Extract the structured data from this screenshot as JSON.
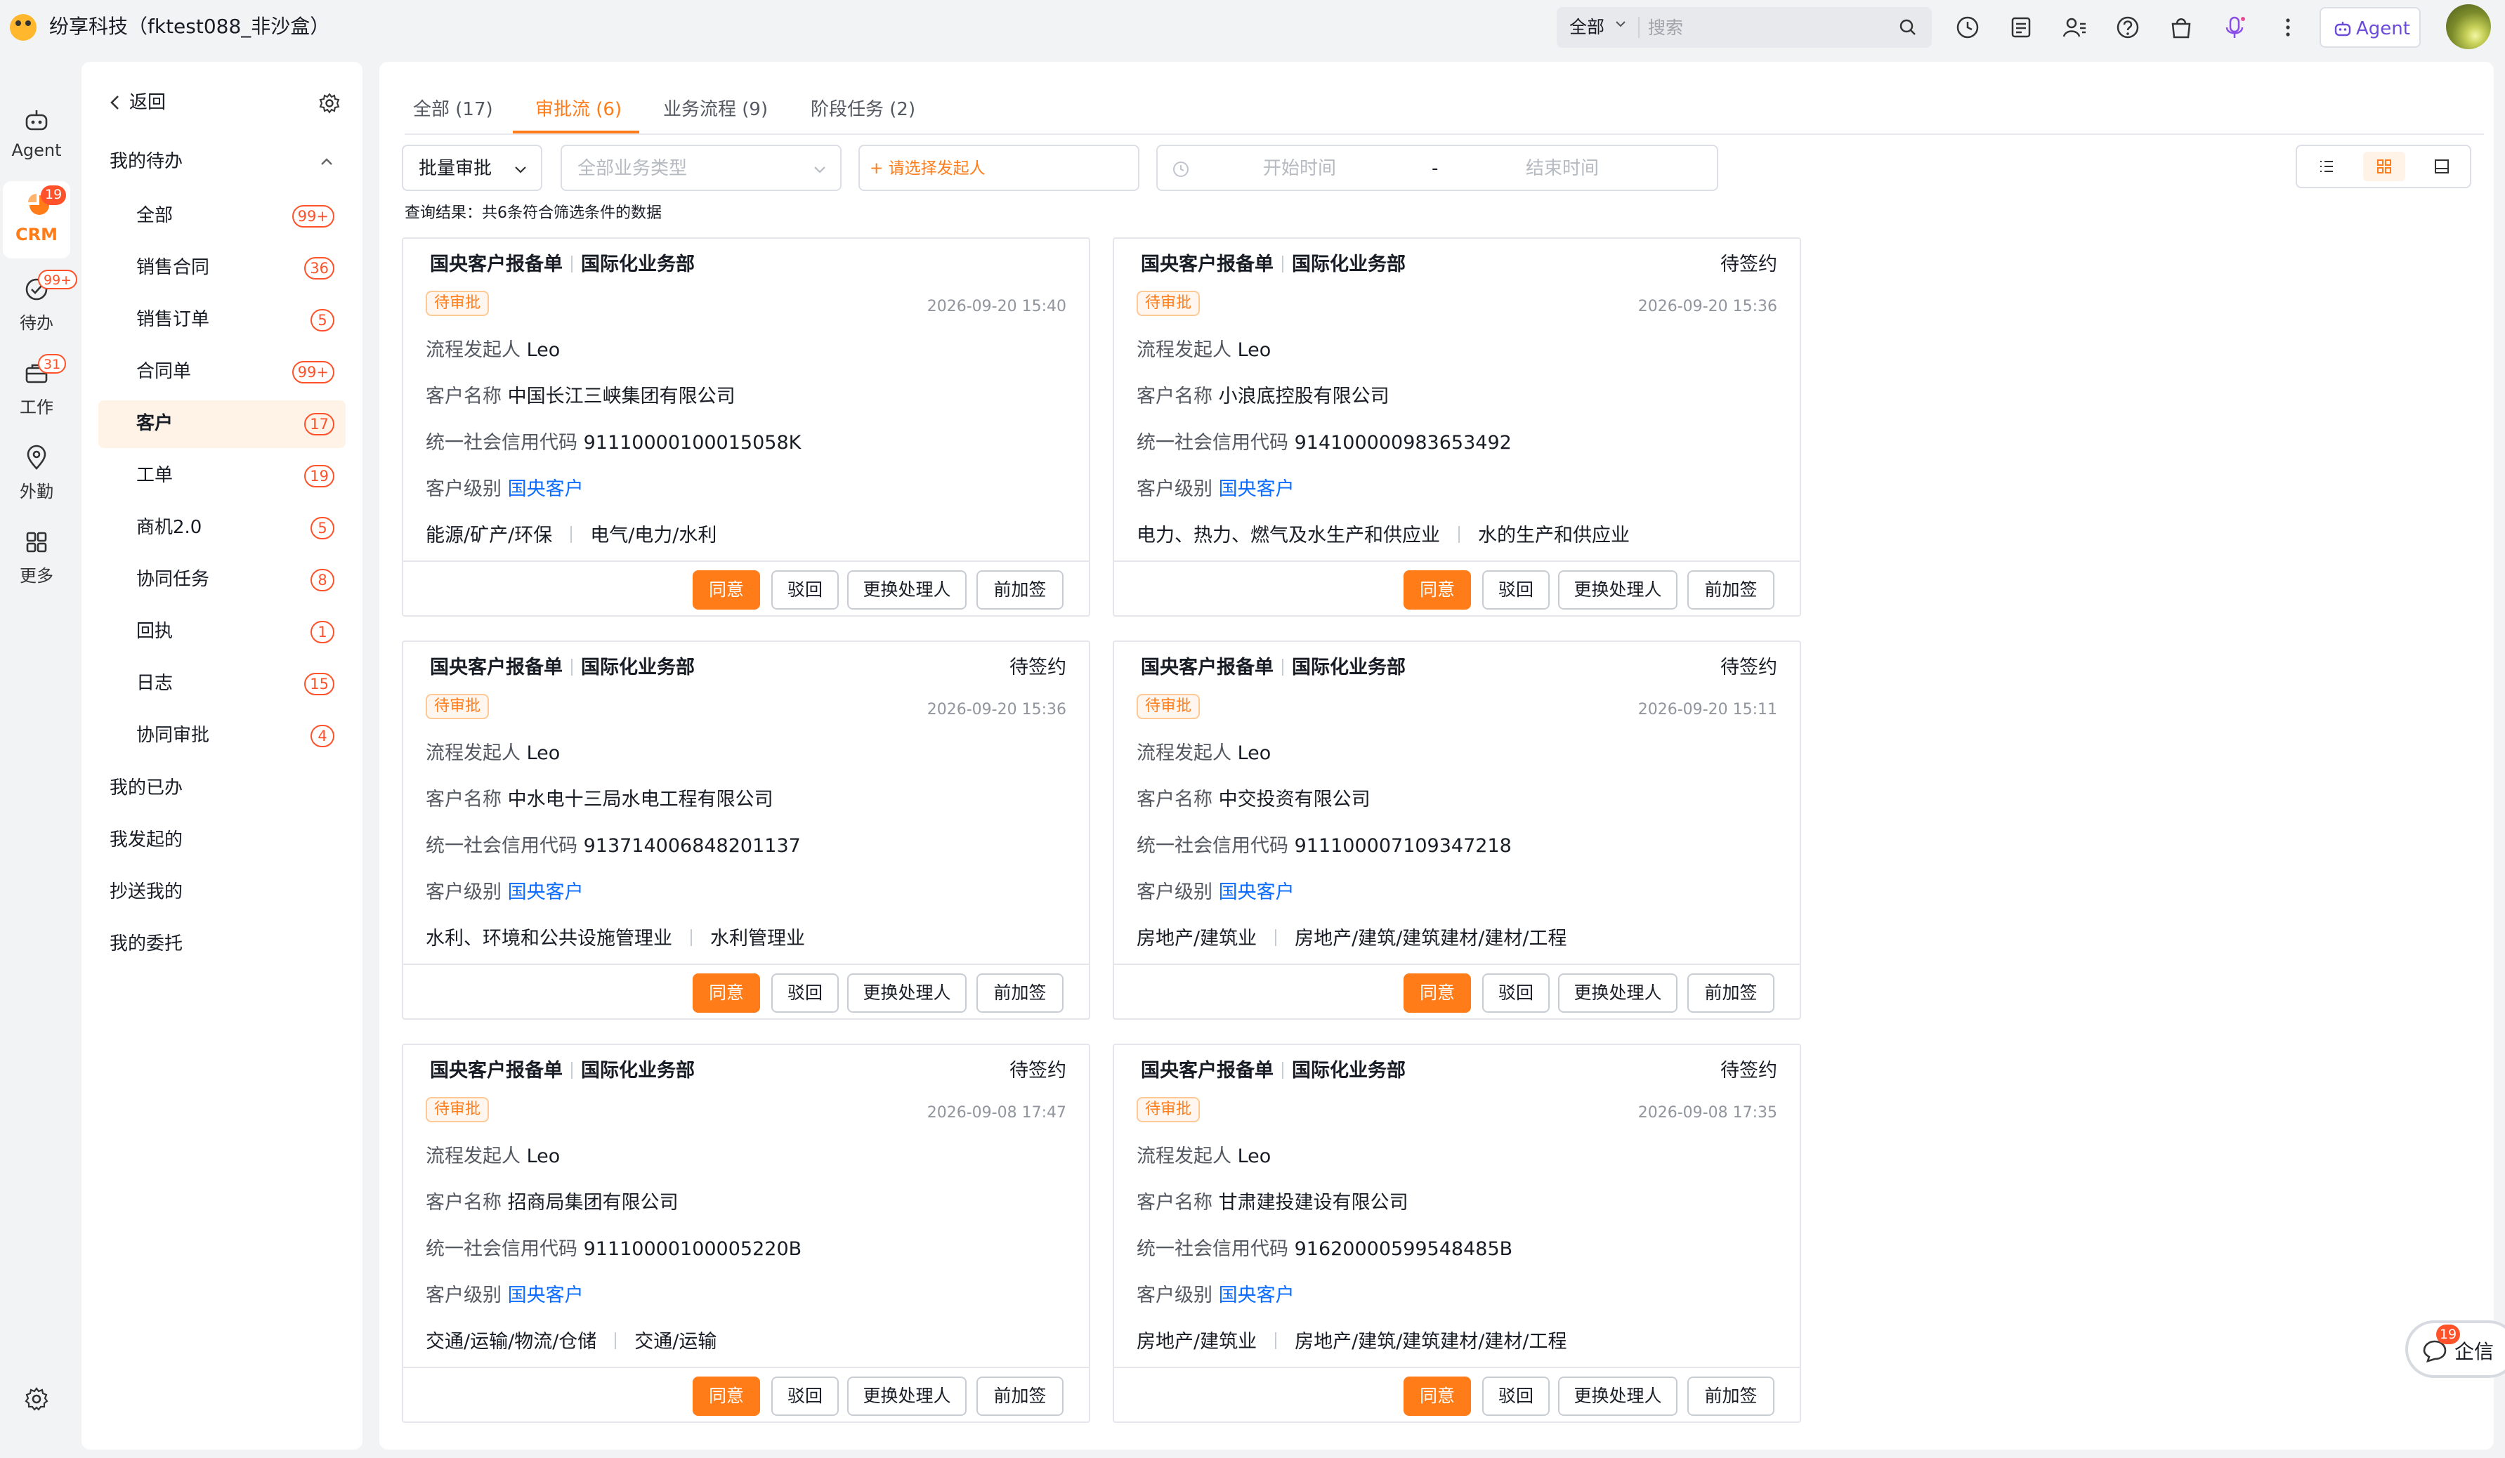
{
  "app": {
    "title": "纷享科技（fktest088_非沙盒）"
  },
  "search": {
    "scope": "全部",
    "placeholder": "搜索"
  },
  "header": {
    "agent_label": "Agent"
  },
  "leftnav": [
    {
      "label": "Agent",
      "badge": ""
    },
    {
      "label": "CRM",
      "badge": "19"
    },
    {
      "label": "待办",
      "badge": "99+"
    },
    {
      "label": "工作",
      "badge": "31"
    },
    {
      "label": "外勤",
      "badge": ""
    },
    {
      "label": "更多",
      "badge": ""
    }
  ],
  "sidebar": {
    "back_label": "返回",
    "group_todo": "我的待办",
    "items": [
      {
        "label": "全部",
        "badge": "99+"
      },
      {
        "label": "销售合同",
        "badge": "36"
      },
      {
        "label": "销售订单",
        "badge": "5"
      },
      {
        "label": "合同单",
        "badge": "99+"
      },
      {
        "label": "客户",
        "badge": "17"
      },
      {
        "label": "工单",
        "badge": "19"
      },
      {
        "label": "商机2.0",
        "badge": "5"
      },
      {
        "label": "协同任务",
        "badge": "8"
      },
      {
        "label": "回执",
        "badge": "1"
      },
      {
        "label": "日志",
        "badge": "15"
      },
      {
        "label": "协同审批",
        "badge": "4"
      }
    ],
    "groups": [
      "我的已办",
      "我发起的",
      "抄送我的",
      "我的委托"
    ]
  },
  "tabs": [
    {
      "label": "全部 (17)"
    },
    {
      "label": "审批流 (6)"
    },
    {
      "label": "业务流程 (9)"
    },
    {
      "label": "阶段任务 (2)"
    }
  ],
  "filters": {
    "batch": "批量审批",
    "biz_type_placeholder": "全部业务类型",
    "initiator": "+ 请选择发起人",
    "start_placeholder": "开始时间",
    "range_sep": "-",
    "end_placeholder": "结束时间"
  },
  "result_text": "查询结果：共6条符合筛选条件的数据",
  "card_labels": {
    "initiator": "流程发起人",
    "customer": "客户名称",
    "credit_code": "统一社会信用代码",
    "level": "客户级别"
  },
  "card_buttons": {
    "approve": "同意",
    "reject": "驳回",
    "change": "更换处理人",
    "add_sign": "前加签"
  },
  "cards": [
    {
      "title": "国央客户报备单",
      "dept": "国际化业务部",
      "status": "",
      "tag": "待审批",
      "time": "2026-09-20 15:40",
      "initiator": "Leo",
      "customer": "中国长江三峡集团有限公司",
      "code": "91110000100015058K",
      "level": "国央客户",
      "industry1": "能源/矿产/环保",
      "industry2": "电气/电力/水利"
    },
    {
      "title": "国央客户报备单",
      "dept": "国际化业务部",
      "status": "待签约",
      "tag": "待审批",
      "time": "2026-09-20 15:36",
      "initiator": "Leo",
      "customer": "小浪底控股有限公司",
      "code": "914100000983653492",
      "level": "国央客户",
      "industry1": "电力、热力、燃气及水生产和供应业",
      "industry2": "水的生产和供应业"
    },
    {
      "title": "国央客户报备单",
      "dept": "国际化业务部",
      "status": "待签约",
      "tag": "待审批",
      "time": "2026-09-20 15:36",
      "initiator": "Leo",
      "customer": "中水电十三局水电工程有限公司",
      "code": "913714006848201137",
      "level": "国央客户",
      "industry1": "水利、环境和公共设施管理业",
      "industry2": "水利管理业"
    },
    {
      "title": "国央客户报备单",
      "dept": "国际化业务部",
      "status": "待签约",
      "tag": "待审批",
      "time": "2026-09-20 15:11",
      "initiator": "Leo",
      "customer": "中交投资有限公司",
      "code": "911100007109347218",
      "level": "国央客户",
      "industry1": "房地产/建筑业",
      "industry2": "房地产/建筑/建筑建材/建材/工程"
    },
    {
      "title": "国央客户报备单",
      "dept": "国际化业务部",
      "status": "待签约",
      "tag": "待审批",
      "time": "2026-09-08 17:47",
      "initiator": "Leo",
      "customer": "招商局集团有限公司",
      "code": "91110000100005220B",
      "level": "国央客户",
      "industry1": "交通/运输/物流/仓储",
      "industry2": "交通/运输"
    },
    {
      "title": "国央客户报备单",
      "dept": "国际化业务部",
      "status": "待签约",
      "tag": "待审批",
      "time": "2026-09-08 17:35",
      "initiator": "Leo",
      "customer": "甘肃建投建设有限公司",
      "code": "91620000599548485B",
      "level": "国央客户",
      "industry1": "房地产/建筑业",
      "industry2": "房地产/建筑/建筑建材/建材/工程"
    }
  ],
  "qixin": {
    "label": "企信",
    "badge": "19"
  },
  "colors": {
    "accent": "#ff7c19",
    "badge": "#ff522a",
    "link": "#0c6cff"
  }
}
